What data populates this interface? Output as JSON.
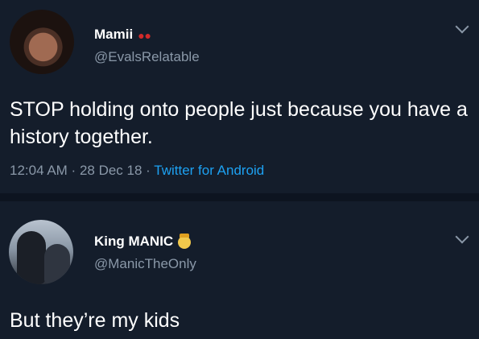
{
  "tweet_1": {
    "display_name": "Mamii",
    "name_badge": "cherries",
    "handle": "@EvalsRelatable",
    "text": "STOP holding onto people just because you have a history together.",
    "time": "12:04 AM",
    "date": "28 Dec 18",
    "source": "Twitter for Android",
    "separator": " · "
  },
  "tweet_2": {
    "display_name": "King MANIC",
    "name_badge": "emoji",
    "handle": "@ManicTheOnly",
    "text": "But they’re my kids"
  },
  "icons": {
    "menu": "chevron-down-icon"
  },
  "colors": {
    "background": "#141d2b",
    "secondary_text": "#8a98a8",
    "link": "#1da1f2"
  }
}
